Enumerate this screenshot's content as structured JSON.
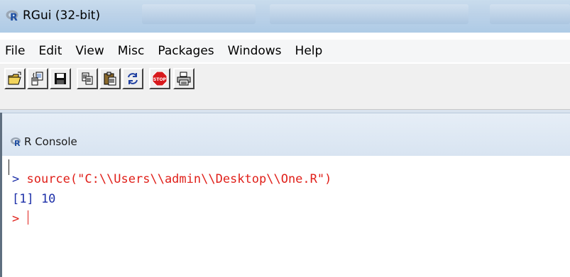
{
  "window": {
    "title": "RGui (32-bit)"
  },
  "menu": {
    "items": [
      "File",
      "Edit",
      "View",
      "Misc",
      "Packages",
      "Windows",
      "Help"
    ]
  },
  "toolbar": {
    "buttons": [
      {
        "name": "open-script-button",
        "icon": "folder-open-icon"
      },
      {
        "name": "load-workspace-button",
        "icon": "load-workspace-icon"
      },
      {
        "name": "save-workspace-button",
        "icon": "floppy-disk-icon"
      },
      {
        "name": "copy-button",
        "icon": "copy-icon"
      },
      {
        "name": "paste-button",
        "icon": "paste-icon"
      },
      {
        "name": "copy-paste-button",
        "icon": "refresh-icon"
      },
      {
        "name": "stop-button",
        "icon": "stop-sign-icon"
      },
      {
        "name": "print-button",
        "icon": "printer-icon"
      }
    ],
    "stop_label": "STOP"
  },
  "console": {
    "title": "R Console",
    "lines": [
      {
        "prompt": "> ",
        "text": "source(\"C:\\\\Users\\\\admin\\\\Desktop\\\\One.R\")"
      },
      {
        "prompt": "",
        "text": "[1] 10"
      },
      {
        "prompt": "> ",
        "text": ""
      }
    ]
  },
  "colors": {
    "prompt": "#e0201a",
    "output": "#1c2fa8",
    "r_logo": "#1f4fa3"
  }
}
